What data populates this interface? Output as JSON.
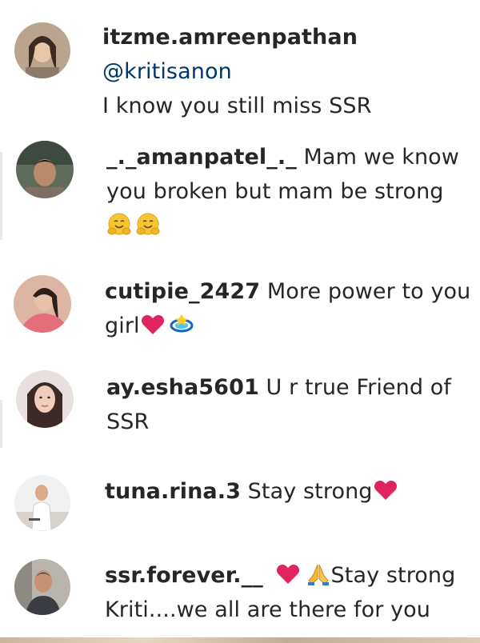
{
  "comments": [
    {
      "username": "itzme.amreenpathan",
      "mention": "@kritisanon",
      "lines": [
        "I know you still miss SSR"
      ],
      "emojis": []
    },
    {
      "username": "_._amanpatel_._",
      "text_line1": "Mam we know",
      "line2": "you broken but mam be strong",
      "emojis": [
        "hugging-face",
        "hugging-face"
      ]
    },
    {
      "username": "cutipie_2427",
      "text_line1": "More power to you",
      "line2": "girl",
      "emojis": [
        "red-heart",
        "dizzy-swirl"
      ]
    },
    {
      "username": "ay.esha5601",
      "text_line1": "U r true Friend of",
      "line2": "SSR"
    },
    {
      "username": "tuna.rina.3",
      "text_line1": "Stay strong",
      "emojis": [
        "red-heart"
      ]
    },
    {
      "username": "ssr.forever.__",
      "text_line1": "Stay strong",
      "line2": "Kriti....we all are there for you",
      "emojis": [
        "red-heart",
        "folded-hands"
      ]
    }
  ],
  "colors": {
    "text": "#262626",
    "mention": "#00376b",
    "heart": "#e0245e"
  }
}
